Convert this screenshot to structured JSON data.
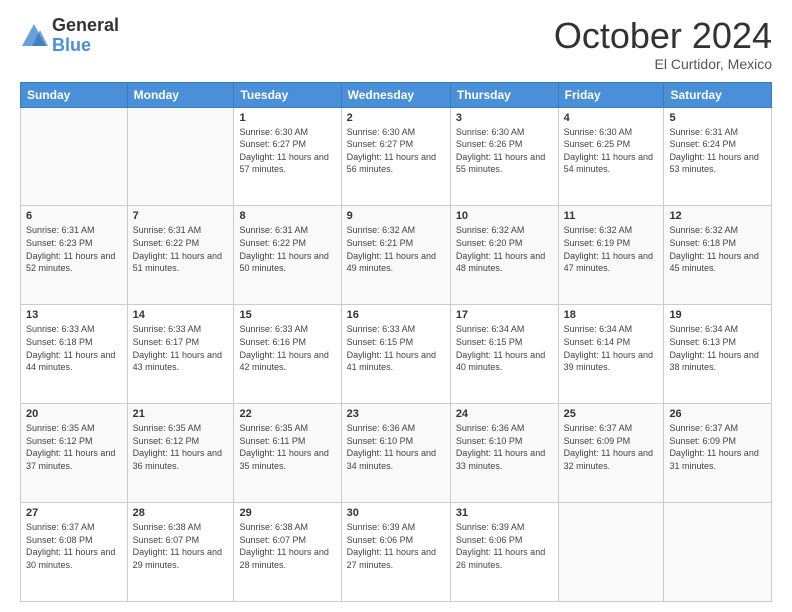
{
  "logo": {
    "general": "General",
    "blue": "Blue"
  },
  "header": {
    "month": "October 2024",
    "location": "El Curtidor, Mexico"
  },
  "days_header": [
    "Sunday",
    "Monday",
    "Tuesday",
    "Wednesday",
    "Thursday",
    "Friday",
    "Saturday"
  ],
  "weeks": [
    [
      {
        "day": "",
        "sunrise": "",
        "sunset": "",
        "daylight": ""
      },
      {
        "day": "",
        "sunrise": "",
        "sunset": "",
        "daylight": ""
      },
      {
        "day": "1",
        "sunrise": "Sunrise: 6:30 AM",
        "sunset": "Sunset: 6:27 PM",
        "daylight": "Daylight: 11 hours and 57 minutes."
      },
      {
        "day": "2",
        "sunrise": "Sunrise: 6:30 AM",
        "sunset": "Sunset: 6:27 PM",
        "daylight": "Daylight: 11 hours and 56 minutes."
      },
      {
        "day": "3",
        "sunrise": "Sunrise: 6:30 AM",
        "sunset": "Sunset: 6:26 PM",
        "daylight": "Daylight: 11 hours and 55 minutes."
      },
      {
        "day": "4",
        "sunrise": "Sunrise: 6:30 AM",
        "sunset": "Sunset: 6:25 PM",
        "daylight": "Daylight: 11 hours and 54 minutes."
      },
      {
        "day": "5",
        "sunrise": "Sunrise: 6:31 AM",
        "sunset": "Sunset: 6:24 PM",
        "daylight": "Daylight: 11 hours and 53 minutes."
      }
    ],
    [
      {
        "day": "6",
        "sunrise": "Sunrise: 6:31 AM",
        "sunset": "Sunset: 6:23 PM",
        "daylight": "Daylight: 11 hours and 52 minutes."
      },
      {
        "day": "7",
        "sunrise": "Sunrise: 6:31 AM",
        "sunset": "Sunset: 6:22 PM",
        "daylight": "Daylight: 11 hours and 51 minutes."
      },
      {
        "day": "8",
        "sunrise": "Sunrise: 6:31 AM",
        "sunset": "Sunset: 6:22 PM",
        "daylight": "Daylight: 11 hours and 50 minutes."
      },
      {
        "day": "9",
        "sunrise": "Sunrise: 6:32 AM",
        "sunset": "Sunset: 6:21 PM",
        "daylight": "Daylight: 11 hours and 49 minutes."
      },
      {
        "day": "10",
        "sunrise": "Sunrise: 6:32 AM",
        "sunset": "Sunset: 6:20 PM",
        "daylight": "Daylight: 11 hours and 48 minutes."
      },
      {
        "day": "11",
        "sunrise": "Sunrise: 6:32 AM",
        "sunset": "Sunset: 6:19 PM",
        "daylight": "Daylight: 11 hours and 47 minutes."
      },
      {
        "day": "12",
        "sunrise": "Sunrise: 6:32 AM",
        "sunset": "Sunset: 6:18 PM",
        "daylight": "Daylight: 11 hours and 45 minutes."
      }
    ],
    [
      {
        "day": "13",
        "sunrise": "Sunrise: 6:33 AM",
        "sunset": "Sunset: 6:18 PM",
        "daylight": "Daylight: 11 hours and 44 minutes."
      },
      {
        "day": "14",
        "sunrise": "Sunrise: 6:33 AM",
        "sunset": "Sunset: 6:17 PM",
        "daylight": "Daylight: 11 hours and 43 minutes."
      },
      {
        "day": "15",
        "sunrise": "Sunrise: 6:33 AM",
        "sunset": "Sunset: 6:16 PM",
        "daylight": "Daylight: 11 hours and 42 minutes."
      },
      {
        "day": "16",
        "sunrise": "Sunrise: 6:33 AM",
        "sunset": "Sunset: 6:15 PM",
        "daylight": "Daylight: 11 hours and 41 minutes."
      },
      {
        "day": "17",
        "sunrise": "Sunrise: 6:34 AM",
        "sunset": "Sunset: 6:15 PM",
        "daylight": "Daylight: 11 hours and 40 minutes."
      },
      {
        "day": "18",
        "sunrise": "Sunrise: 6:34 AM",
        "sunset": "Sunset: 6:14 PM",
        "daylight": "Daylight: 11 hours and 39 minutes."
      },
      {
        "day": "19",
        "sunrise": "Sunrise: 6:34 AM",
        "sunset": "Sunset: 6:13 PM",
        "daylight": "Daylight: 11 hours and 38 minutes."
      }
    ],
    [
      {
        "day": "20",
        "sunrise": "Sunrise: 6:35 AM",
        "sunset": "Sunset: 6:12 PM",
        "daylight": "Daylight: 11 hours and 37 minutes."
      },
      {
        "day": "21",
        "sunrise": "Sunrise: 6:35 AM",
        "sunset": "Sunset: 6:12 PM",
        "daylight": "Daylight: 11 hours and 36 minutes."
      },
      {
        "day": "22",
        "sunrise": "Sunrise: 6:35 AM",
        "sunset": "Sunset: 6:11 PM",
        "daylight": "Daylight: 11 hours and 35 minutes."
      },
      {
        "day": "23",
        "sunrise": "Sunrise: 6:36 AM",
        "sunset": "Sunset: 6:10 PM",
        "daylight": "Daylight: 11 hours and 34 minutes."
      },
      {
        "day": "24",
        "sunrise": "Sunrise: 6:36 AM",
        "sunset": "Sunset: 6:10 PM",
        "daylight": "Daylight: 11 hours and 33 minutes."
      },
      {
        "day": "25",
        "sunrise": "Sunrise: 6:37 AM",
        "sunset": "Sunset: 6:09 PM",
        "daylight": "Daylight: 11 hours and 32 minutes."
      },
      {
        "day": "26",
        "sunrise": "Sunrise: 6:37 AM",
        "sunset": "Sunset: 6:09 PM",
        "daylight": "Daylight: 11 hours and 31 minutes."
      }
    ],
    [
      {
        "day": "27",
        "sunrise": "Sunrise: 6:37 AM",
        "sunset": "Sunset: 6:08 PM",
        "daylight": "Daylight: 11 hours and 30 minutes."
      },
      {
        "day": "28",
        "sunrise": "Sunrise: 6:38 AM",
        "sunset": "Sunset: 6:07 PM",
        "daylight": "Daylight: 11 hours and 29 minutes."
      },
      {
        "day": "29",
        "sunrise": "Sunrise: 6:38 AM",
        "sunset": "Sunset: 6:07 PM",
        "daylight": "Daylight: 11 hours and 28 minutes."
      },
      {
        "day": "30",
        "sunrise": "Sunrise: 6:39 AM",
        "sunset": "Sunset: 6:06 PM",
        "daylight": "Daylight: 11 hours and 27 minutes."
      },
      {
        "day": "31",
        "sunrise": "Sunrise: 6:39 AM",
        "sunset": "Sunset: 6:06 PM",
        "daylight": "Daylight: 11 hours and 26 minutes."
      },
      {
        "day": "",
        "sunrise": "",
        "sunset": "",
        "daylight": ""
      },
      {
        "day": "",
        "sunrise": "",
        "sunset": "",
        "daylight": ""
      }
    ]
  ]
}
